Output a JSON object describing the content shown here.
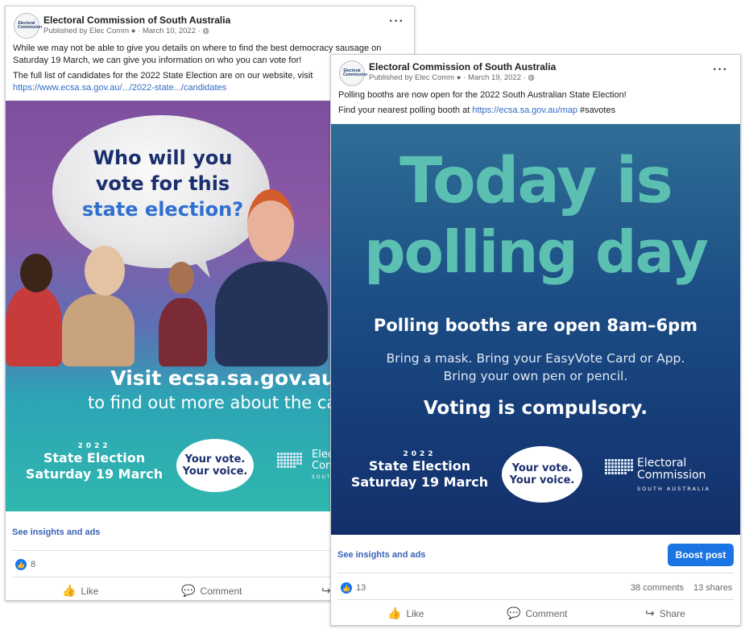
{
  "post1": {
    "page_name": "Electoral Commission of South Australia",
    "published_by": "Published by Elec Comm",
    "date": "March 10, 2022",
    "logo_text": "Electoral Commission",
    "text_line1": "While we may not be able to give you details on where to find the best democracy sausage on",
    "text_line2": "Saturday 19 March, we can give you information on who you can vote for!",
    "text_line3": "The full list of candidates for the 2022 State Election are on our website, visit",
    "link": "https://www.ecsa.sa.gov.au/.../2022-state.../candidates",
    "image": {
      "question_l1": "Who will you",
      "question_l2": "vote for this",
      "question_l3": "state election?",
      "visit_l1": "Visit ecsa.sa.gov.au",
      "visit_l2": "to find out more about the cand",
      "year": "2022",
      "election_l1": "State Election",
      "election_l2": "Saturday 19 March",
      "bubble_l1": "Your vote.",
      "bubble_l2": "Your voice.",
      "ec_l1": "Elect",
      "ec_l2": "Com",
      "ec_l3": "SOUTH"
    },
    "insights": "See insights and ads",
    "likes": "8",
    "actions": {
      "like": "Like",
      "comment": "Comment"
    }
  },
  "post2": {
    "page_name": "Electoral Commission of South Australia",
    "published_by": "Published by Elec Comm",
    "date": "March 19, 2022",
    "logo_text": "Electoral Commission",
    "text_line1": "Polling booths are now open for the 2022 South Australian State Election!",
    "text_prefix": "Find your nearest polling booth at ",
    "link": "https://ecsa.sa.gov.au/map",
    "hashtag": "#savotes",
    "image": {
      "big_l1": "Today is",
      "big_l2": "polling day",
      "hours": "Polling booths are open 8am–6pm",
      "bring_l1": "Bring a mask. Bring your EasyVote Card or App.",
      "bring_l2": "Bring your own pen or pencil.",
      "compulsory": "Voting is compulsory.",
      "year": "2022",
      "election_l1": "State Election",
      "election_l2": "Saturday 19 March",
      "bubble_l1": "Your vote.",
      "bubble_l2": "Your voice.",
      "ec_l1": "Electoral",
      "ec_l2": "Commission",
      "ec_l3": "SOUTH AUSTRALIA"
    },
    "insights": "See insights and ads",
    "boost": "Boost post",
    "likes": "13",
    "comments": "38 comments",
    "shares": "13 shares",
    "actions": {
      "like": "Like",
      "comment": "Comment",
      "share": "Share"
    }
  },
  "colors": {
    "accent": "#1b74e4",
    "link": "#2f6cc5",
    "teal": "#5bbfb2",
    "navy": "#163e79"
  }
}
